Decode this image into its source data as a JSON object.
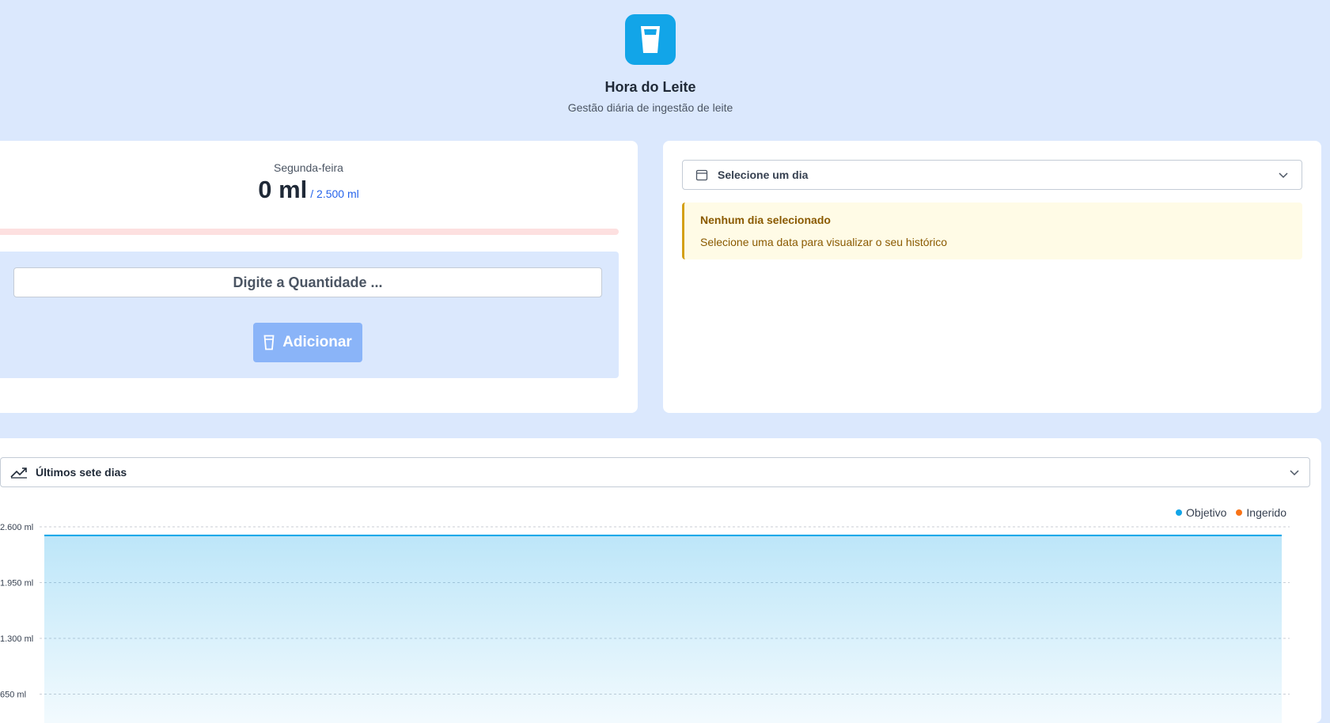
{
  "header": {
    "title": "Hora do Leite",
    "subtitle": "Gestão diária de ingestão de leite",
    "logo_icon": "milk-glass-icon"
  },
  "today": {
    "day_name": "Segunda-feira",
    "amount": "0 ml",
    "goal": "/ 2.500 ml",
    "progress_fraction": 0,
    "input_placeholder": "Digite a Quantidade ...",
    "add_label": "Adicionar"
  },
  "history": {
    "select_label": "Selecione um dia",
    "alert_title": "Nenhum dia selecionado",
    "alert_text": "Selecione uma data para visualizar o seu histórico"
  },
  "chart_section": {
    "title": "Últimos sete dias"
  },
  "colors": {
    "accent": "#12a5e8",
    "goal_series": "#12a5e8",
    "intake_series": "#f97316"
  },
  "chart_data": {
    "type": "area",
    "title": "",
    "xlabel": "",
    "ylabel": "",
    "y_ticks": [
      "650 ml",
      "1.300 ml",
      "1.950 ml",
      "2.600 ml"
    ],
    "y_tick_values": [
      650,
      1300,
      1950,
      2600
    ],
    "ylim": [
      0,
      2600
    ],
    "grid": true,
    "legend_position": "top-right",
    "series": [
      {
        "name": "Objetivo",
        "values": [
          2500,
          2500,
          2500,
          2500,
          2500,
          2500,
          2500
        ]
      },
      {
        "name": "Ingerido",
        "values": [
          0,
          0,
          0,
          0,
          0,
          0,
          0
        ]
      }
    ]
  }
}
